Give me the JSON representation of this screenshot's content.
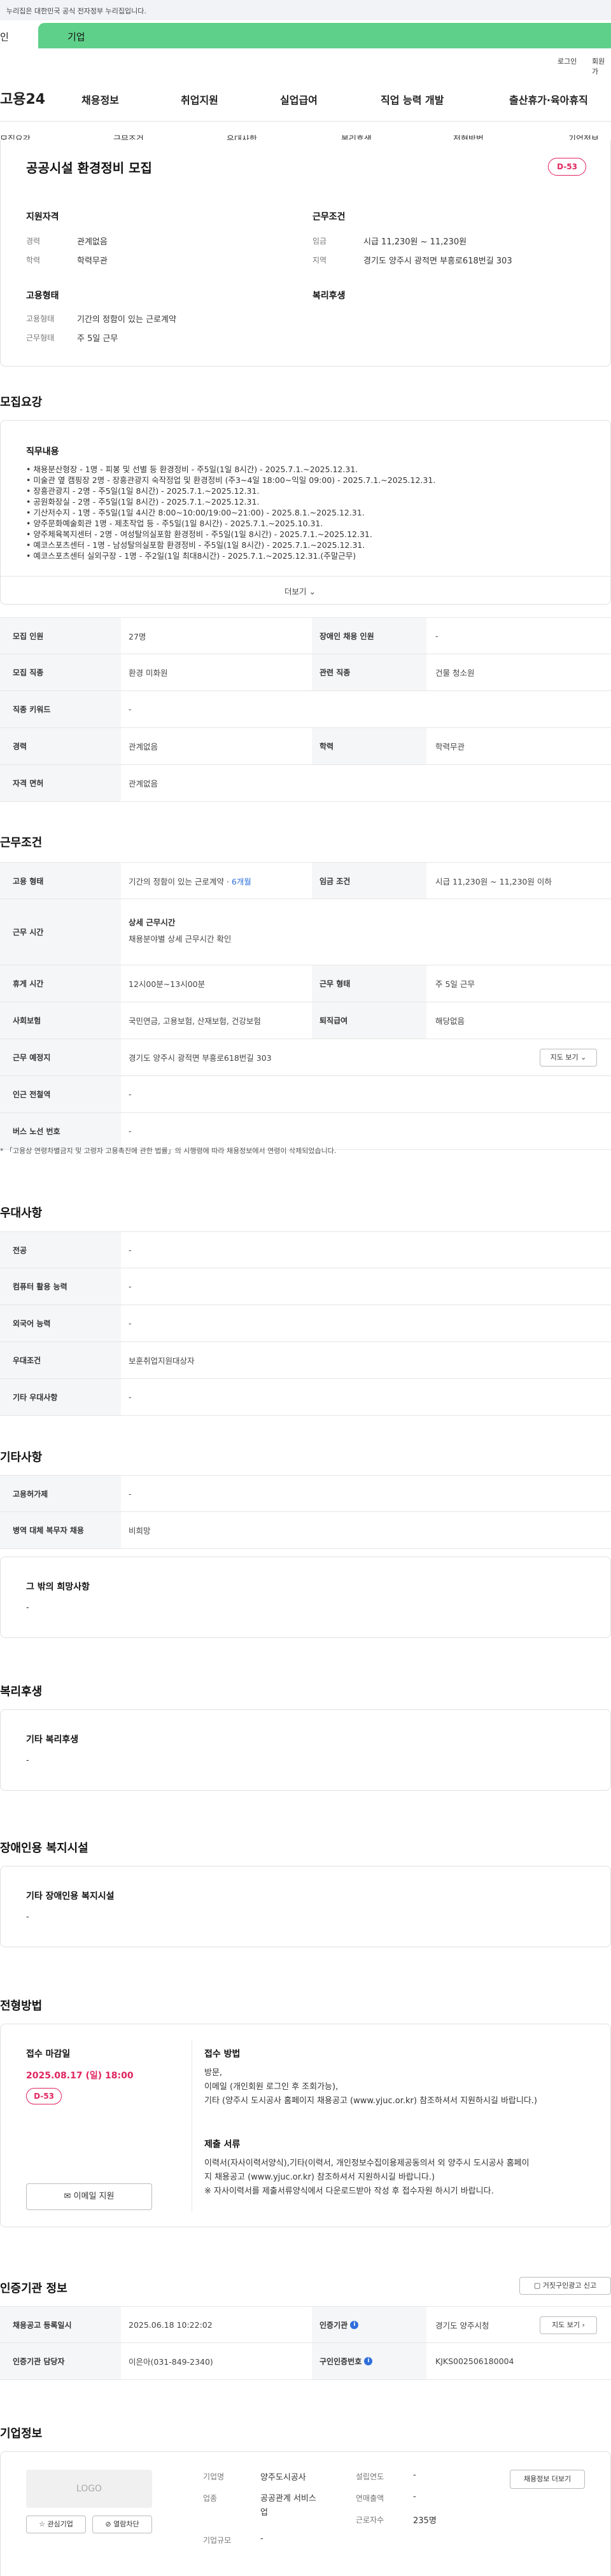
{
  "gov_banner": "누리집은 대한민국 공식 전자정부 누리집입니다.",
  "top_tabs": [
    "인",
    "기업"
  ],
  "util": [
    "로그인",
    "회원가"
  ],
  "logo": "고용24",
  "gnb": [
    "채용정보",
    "취업지원",
    "실업급여",
    "직업 능력 개발",
    "출산휴가·육아휴직"
  ],
  "subnav": [
    "모집요강",
    "근무조건",
    "우대사항",
    "복리후생",
    "전형방법",
    "기업정보"
  ],
  "summary": {
    "title": "공공시설 환경정비 모집",
    "dday": "D-53",
    "qual_h": "지원자격",
    "career_l": "경력",
    "career_v": "관계없음",
    "edu_l": "학력",
    "edu_v": "학력무관",
    "work_h": "근무조건",
    "wage_l": "임금",
    "wage_v": "시급 11,230원 ~ 11,230원",
    "loc_l": "지역",
    "loc_v": "경기도 양주시 광적면 부흥로618번길 303",
    "emp_h": "고용형태",
    "emptype_l": "고용형태",
    "emptype_v": "기간의 정함이 있는 근로계약",
    "days_l": "근무형태",
    "days_v": "주 5일 근무",
    "welfare_h": "복리후생"
  },
  "recruit": {
    "heading": "모집요강",
    "duty_h": "직무내용",
    "duties": [
      "• 채용분산형장 - 1명 - 피봉 및 선별 등 환경정비 - 주5일(1일 8시간) - 2025.7.1.~2025.12.31.",
      "• 미술관 옆 캠핑장 2명 - 장흥관광지 숙작정업 및 환경정비 (주3~4일 18:00~익일 09:00) - 2025.7.1.~2025.12.31.",
      "• 장흥관광지 - 2명 - 주5일(1일 8시간) - 2025.7.1.~2025.12.31.",
      "• 공원화장실 - 2명 - 주5일(1일 8시간) - 2025.7.1.~2025.12.31.",
      "• 기산저수지 - 1명 - 주5일(1일 4시간 8:00~10:00/19:00~21:00) - 2025.8.1.~2025.12.31.",
      "• 양주문화예술회관 1명 - 제초작업 등 - 주5일(1일 8시간) - 2025.7.1.~2025.10.31.",
      "• 양주체육복지센터 - 2명 - 여성탈의실포함 환경정비 - 주5일(1일 8시간) - 2025.7.1.~2025.12.31.",
      "• 예코스포츠센터 - 1명 - 남성탈의실포함 환경정비 - 주5일(1일 8시간) - 2025.7.1.~2025.12.31.",
      "• 예코스포츠센터 실외구장 - 1명 - 주2일(1일 최대8시간) - 2025.7.1.~2025.12.31.(주말근무)"
    ],
    "more": "더보기",
    "rows": [
      [
        "모집 인원",
        "27명",
        "장애인 채용 인원",
        "-"
      ],
      [
        "모집 직종",
        "환경 미화원",
        "관련 직종",
        "건물 청소원"
      ],
      [
        "직종 키워드",
        "-",
        "",
        ""
      ],
      [
        "경력",
        "관계없음",
        "학력",
        "학력무관"
      ],
      [
        "자격 면허",
        "관계없음",
        "",
        ""
      ]
    ]
  },
  "work": {
    "heading": "근무조건",
    "emp_l": "고용 형태",
    "emp_v": "기간의 정함이 있는 근로계약 · ",
    "emp_v2": "6개월",
    "wage_l": "임금 조건",
    "wage_v": "시급 11,230원 ~ 11,230원 이하",
    "time_l": "근무 시간",
    "time_h": "상세 근무시간",
    "time_v": "채용분야별 상세 근무시간 확인",
    "rest_l": "휴게 시간",
    "rest_v": "12시00분~13시00분",
    "form_l": "근무 형태",
    "form_v": "주 5일 근무",
    "ins_l": "사회보험",
    "ins_v": "국민연금, 고용보험, 산재보험, 건강보험",
    "sev_l": "퇴직급여",
    "sev_v": "해당없음",
    "place_l": "근무 예정지",
    "place_v": "경기도 양주시 광적면 부흥로618번길 303",
    "map": "지도 보기",
    "sub_l": "인근 전철역",
    "sub_v": "-",
    "bus_l": "버스 노선 번호",
    "bus_v": "-",
    "note": "* 「고용상 연령차별금지 및 고령자 고용촉진에 관한 법률」의 시행령에 따라 채용정보에서 연령이 삭제되었습니다."
  },
  "pref": {
    "heading": "우대사항",
    "rows": [
      [
        "전공",
        "-"
      ],
      [
        "컴퓨터 활용 능력",
        "-"
      ],
      [
        "외국어 능력",
        "-"
      ],
      [
        "우대조건",
        "보훈취업지원대상자"
      ],
      [
        "기타 우대사항",
        "-"
      ]
    ]
  },
  "etc": {
    "heading": "기타사항",
    "rows": [
      [
        "고용허가제",
        "-"
      ],
      [
        "병역 대체 복무자 채용",
        "비희망"
      ]
    ],
    "hope_h": "그 밖의 희망사항",
    "hope_v": "-"
  },
  "welfare": {
    "heading": "복리후생",
    "h": "기타 복리후생",
    "v": "-"
  },
  "disabled": {
    "heading": "장애인용 복지시설",
    "h": "기타 장애인용 복지시설",
    "v": "-"
  },
  "process": {
    "heading": "전형방법",
    "deadline_h": "접수 마감일",
    "deadline": "2025.08.17 (일) 18:00",
    "dday": "D-53",
    "email_btn": "이메일 지원",
    "method_h": "접수 방법",
    "methods": [
      "방문,",
      "이메일 (개인회원 로그인 후 조회가능),",
      "기타 (양주시 도시공사 홈페이지 채용공고 (www.yjuc.or.kr) 참조하셔서 지원하시길 바랍니다.)"
    ],
    "docs_h": "제출 서류",
    "docs": [
      "이력서(자사이력서양식),기타(이력서, 개인정보수집이용제공동의서 외  양주시 도시공사 홈페이",
      "지 채용공고 (www.yjuc.or.kr) 참조하셔서 지원하시길 바랍니다.)",
      "※ 자사이력서를 제출서류양식에서 다운로드받아 작성 후 접수자원 하시기 바랍니다."
    ]
  },
  "agency": {
    "heading": "인증기관 정보",
    "report": "거짓구인광고 신고",
    "reg_l": "채용공고 등록일시",
    "reg_v": "2025.06.18 10:22:02",
    "org_l": "인증기관",
    "org_v": "경기도 양주시청",
    "map": "지도 보기",
    "staff_l": "인증기관 담당자",
    "staff_v": "이은아(031-849-2340)",
    "no_l": "구인인증번호",
    "no_v": "KJKS002506180004"
  },
  "company": {
    "heading": "기업정보",
    "logo": "LOGO",
    "fav": "관심기업",
    "block": "열람차단",
    "name_l": "기업명",
    "name_v": "양주도시공사",
    "ind_l": "업종",
    "ind_v": [
      "공공관계 서비스",
      "업"
    ],
    "size_l": "기업규모",
    "size_v": "-",
    "est_l": "설립연도",
    "est_v": "-",
    "rev_l": "연매출액",
    "rev_v": "-",
    "emp_l": "근로자수",
    "emp_v": "235명",
    "btn": "채용정보 더보기"
  }
}
